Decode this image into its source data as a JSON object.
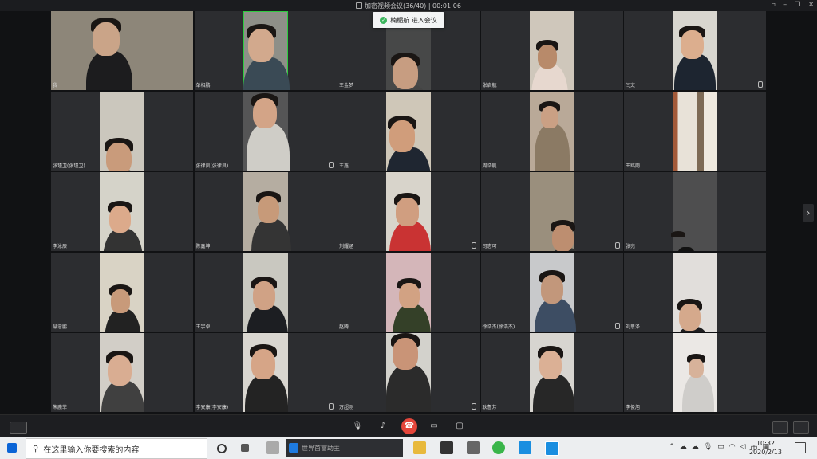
{
  "window": {
    "title": "加密视频会议(36/40) | 00:01:06",
    "controls": [
      "▫",
      "–",
      "❐",
      "✕"
    ]
  },
  "toast": {
    "icon": "check-circle-icon",
    "text": "楠楣航 进入会议",
    "color": "#3bb55d"
  },
  "participants": [
    {
      "name": "我",
      "has_mic_icon": false
    },
    {
      "name": "单相鹏",
      "has_mic_icon": false
    },
    {
      "name": "王金梦",
      "has_mic_icon": false
    },
    {
      "name": "张启航",
      "has_mic_icon": false
    },
    {
      "name": "闫文",
      "has_mic_icon": true
    },
    {
      "name": "张瑾卫(张瑾卫)",
      "has_mic_icon": false
    },
    {
      "name": "张律良(张律良)",
      "has_mic_icon": true
    },
    {
      "name": "王鑫",
      "has_mic_icon": false
    },
    {
      "name": "周浩帆",
      "has_mic_icon": false
    },
    {
      "name": "田銘雨",
      "has_mic_icon": false
    },
    {
      "name": "李泳辰",
      "has_mic_icon": false
    },
    {
      "name": "陈鑫坤",
      "has_mic_icon": false
    },
    {
      "name": "刘耀涵",
      "has_mic_icon": true
    },
    {
      "name": "司志可",
      "has_mic_icon": true
    },
    {
      "name": "张亮",
      "has_mic_icon": false
    },
    {
      "name": "聂忠鹏",
      "has_mic_icon": false
    },
    {
      "name": "王宇卓",
      "has_mic_icon": false
    },
    {
      "name": "赵腾",
      "has_mic_icon": false
    },
    {
      "name": "徐浩杰(徐浩杰)",
      "has_mic_icon": true
    },
    {
      "name": "刘思泽",
      "has_mic_icon": false
    },
    {
      "name": "朱鹿菲",
      "has_mic_icon": false
    },
    {
      "name": "李安康(李安康)",
      "has_mic_icon": true
    },
    {
      "name": "万超刚",
      "has_mic_icon": true
    },
    {
      "name": "耿鲁芳",
      "has_mic_icon": false
    },
    {
      "name": "李俊旭",
      "has_mic_icon": false
    }
  ],
  "toolbar": {
    "layout_button_icon": "grid-layout-icon",
    "buttons": [
      "microphone-icon",
      "speaker-icon",
      "end-call-icon",
      "camera-icon",
      "screen-share-icon"
    ],
    "right_buttons": [
      "invite-user-icon",
      "member-list-icon"
    ]
  },
  "taskbar": {
    "search_placeholder": "在这里输入你要搜索的内容",
    "browser_box_text": "世界首富助主!",
    "ime": "中",
    "time": "10:32",
    "date": "2020/2/13"
  },
  "colors": {
    "end_call": "#e5463b",
    "active_speaker_border": "#2ecc40"
  }
}
